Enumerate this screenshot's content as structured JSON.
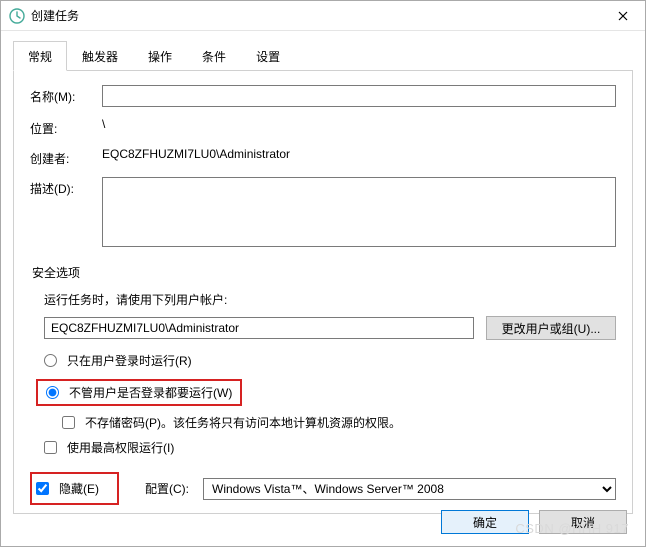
{
  "window": {
    "title": "创建任务"
  },
  "tabs": {
    "general": "常规",
    "triggers": "触发器",
    "actions": "操作",
    "conditions": "条件",
    "settings": "设置"
  },
  "labels": {
    "name": "名称(M):",
    "location": "位置:",
    "author": "创建者:",
    "description": "描述(D):",
    "security_title": "安全选项",
    "run_as_hint": "运行任务时，请使用下列用户帐户:",
    "change_user_btn": "更改用户或组(U)...",
    "radio_logged_on": "只在用户登录时运行(R)",
    "radio_any": "不管用户是否登录都要运行(W)",
    "store_password": "不存储密码(P)。该任务将只有访问本地计算机资源的权限。",
    "highest_priv": "使用最高权限运行(I)",
    "hidden": "隐藏(E)",
    "configure_for": "配置(C):"
  },
  "values": {
    "name": "",
    "location": "\\",
    "author": "EQC8ZFHUZMI7LU0\\Administrator",
    "description": "",
    "account": "EQC8ZFHUZMI7LU0\\Administrator",
    "radio_selected": "any",
    "store_password_checked": false,
    "highest_priv_checked": false,
    "hidden_checked": true,
    "compat": "Windows Vista™、Windows Server™ 2008"
  },
  "buttons": {
    "ok": "确定",
    "cancel": "取消"
  },
  "watermark": "CSDN @HHH 917"
}
